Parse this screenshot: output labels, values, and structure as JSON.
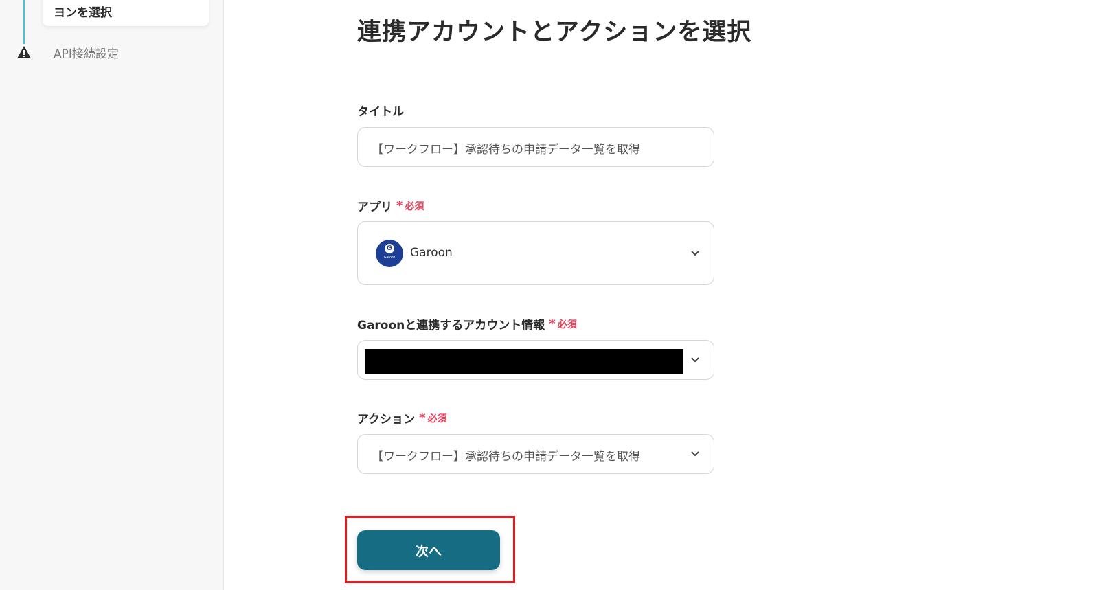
{
  "sidebar": {
    "steps": [
      {
        "label": "ヨンを選択"
      },
      {
        "label": "API接続設定",
        "icon": "warning-icon"
      }
    ]
  },
  "main": {
    "title": "連携アカウントとアクションを選択",
    "required_text": "必須",
    "required_mark": "*",
    "title_field": {
      "label": "タイトル",
      "value": "【ワークフロー】承認待ちの申請データ一覧を取得"
    },
    "app_field": {
      "label": "アプリ",
      "value": "Garoon",
      "logo_letter": "G",
      "logo_text": "Garoon"
    },
    "account_field": {
      "label": "Garoonと連携するアカウント情報"
    },
    "action_field": {
      "label": "アクション",
      "value": "【ワークフロー】承認待ちの申請データ一覧を取得"
    },
    "next_button": {
      "label": "次へ"
    }
  },
  "colors": {
    "accent": "#166c82",
    "required": "#e8425c",
    "highlight": "#e8191f",
    "step_line": "#3fc7d2"
  }
}
